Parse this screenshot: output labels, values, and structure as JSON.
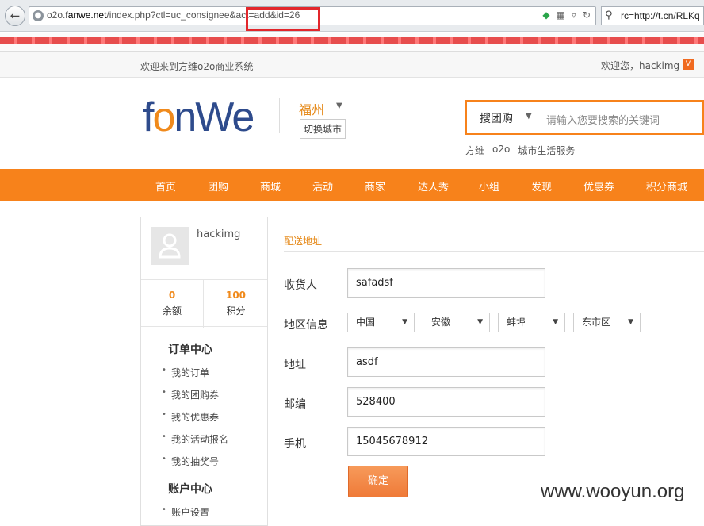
{
  "browser": {
    "url_prefix": "o2o.",
    "url_domain": "fanwe.net",
    "url_path": "/index.php?ctl=uc_consignee&act=add&id=26",
    "search_query": "rc=http://t.cn/RLKq"
  },
  "topbar": {
    "welcome": "欢迎来到方维o2o商业系统",
    "user_welcome": "欢迎您，hackimg",
    "user_badge": "V"
  },
  "header": {
    "logo_parts": [
      "f",
      "o",
      "nWe"
    ],
    "city": "福州",
    "switch_city": "切换城市",
    "search_category": "搜团购",
    "search_placeholder": "请输入您要搜索的关键词",
    "hot_words": [
      "方维",
      "o2o",
      "城市生活服务"
    ]
  },
  "nav": {
    "items": [
      "首页",
      "团购",
      "商城",
      "活动",
      "商家",
      "达人秀",
      "小组",
      "发现",
      "优惠券",
      "积分商城"
    ]
  },
  "sidebar": {
    "username": "hackimg",
    "balance_value": "0",
    "balance_label": "余额",
    "points_value": "100",
    "points_label": "积分",
    "order_center": "订单中心",
    "order_items": [
      "我的订单",
      "我的团购券",
      "我的优惠券",
      "我的活动报名",
      "我的抽奖号"
    ],
    "account_center": "账户中心",
    "account_items": [
      "账户设置"
    ]
  },
  "form": {
    "title": "配送地址",
    "consignee_label": "收货人",
    "consignee_value": "safadsf",
    "region_label": "地区信息",
    "region_country": "中国",
    "region_province": "安徽",
    "region_city": "蚌埠",
    "region_district": "东市区",
    "address_label": "地址",
    "address_value": "asdf",
    "zip_label": "邮编",
    "zip_value": "528400",
    "phone_label": "手机",
    "phone_value": "15045678912",
    "submit_label": "确定"
  },
  "watermark": "www.wooyun.org",
  "colors": {
    "accent": "#f7821b",
    "highlight_box": "#e2262b",
    "logo_blue": "#2e4b8c"
  }
}
